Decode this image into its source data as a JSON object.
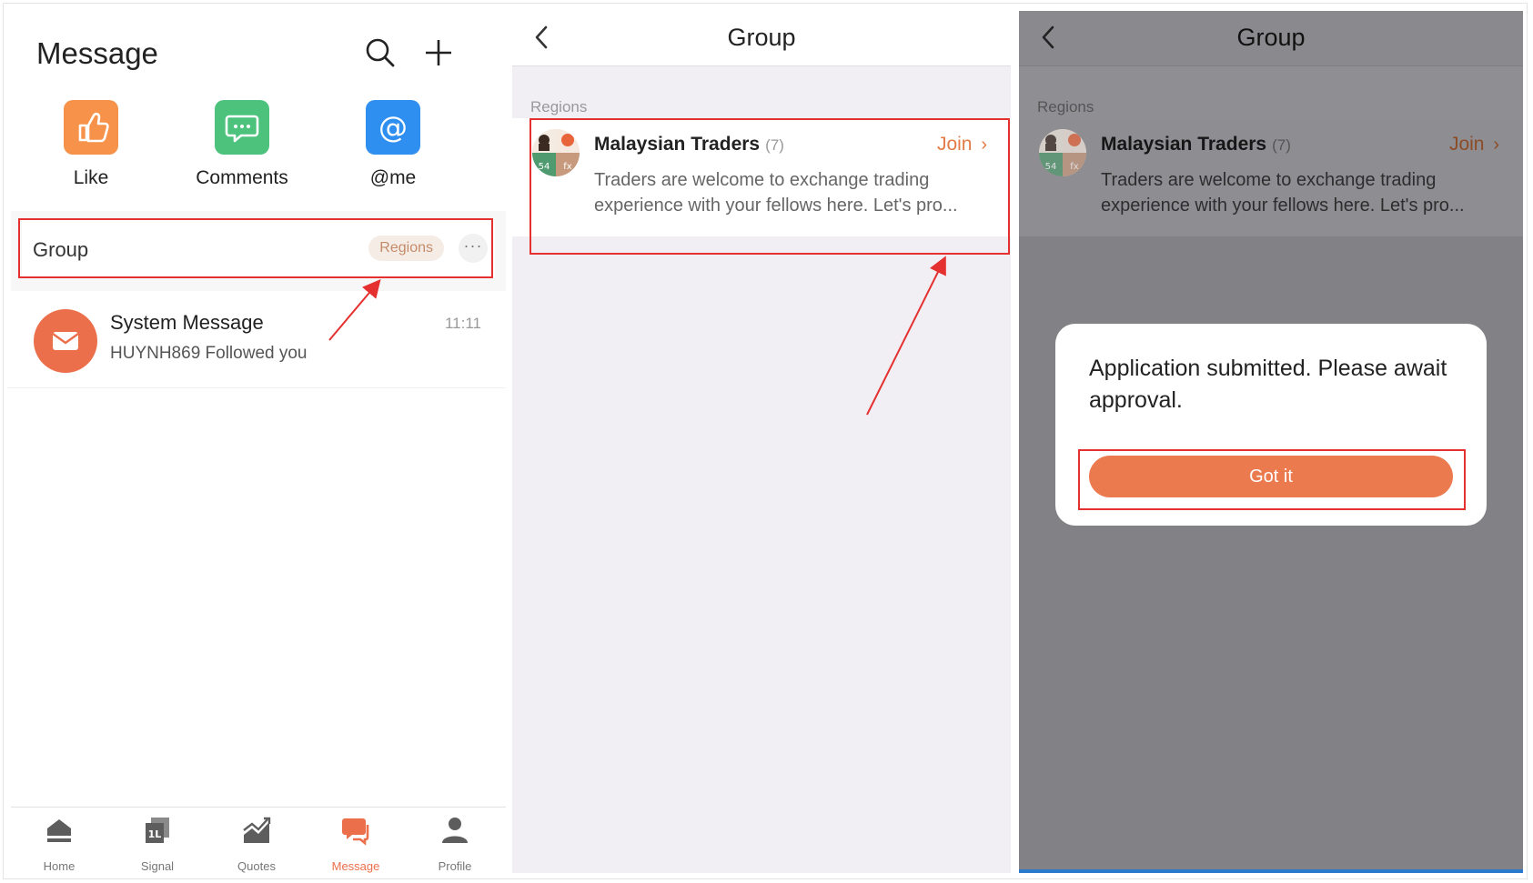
{
  "panel1": {
    "title": "Message",
    "quick_actions": [
      {
        "label": "Like",
        "icon": "thumbs-up-icon",
        "color": "#f7924a"
      },
      {
        "label": "Comments",
        "icon": "chat-bubble-icon",
        "color": "#4cc27d"
      },
      {
        "label": "@me",
        "icon": "at-sign-icon",
        "color": "#2f8ff0"
      }
    ],
    "group_row": {
      "label": "Group",
      "badge": "Regions",
      "more": "···"
    },
    "system_message": {
      "title": "System Message",
      "subtitle": "HUYNH869 Followed you",
      "time": "11:11"
    },
    "tabs": [
      {
        "label": "Home",
        "icon": "home-icon"
      },
      {
        "label": "Signal",
        "icon": "signal-icon"
      },
      {
        "label": "Quotes",
        "icon": "quotes-chart-icon"
      },
      {
        "label": "Message",
        "icon": "message-icon",
        "active": true
      },
      {
        "label": "Profile",
        "icon": "profile-icon"
      }
    ],
    "accent": "#ec6f4b"
  },
  "panel2": {
    "title": "Group",
    "section": "Regions",
    "group": {
      "name": "Malaysian Traders",
      "count": "(7)",
      "join": "Join",
      "description": "Traders are welcome to exchange trading experience with your fellows here. Let's pro...",
      "avatar_badge_1": "54",
      "avatar_badge_2": "fx"
    }
  },
  "panel3": {
    "title": "Group",
    "section": "Regions",
    "group": {
      "name": "Malaysian Traders",
      "count": "(7)",
      "join": "Join",
      "description": "Traders are welcome to exchange trading experience with your fellows here. Let's pro...",
      "avatar_badge_1": "54",
      "avatar_badge_2": "fx"
    },
    "dialog": {
      "message": "Application submitted. Please await approval.",
      "button": "Got it"
    }
  },
  "annotation_color": "#e53030"
}
